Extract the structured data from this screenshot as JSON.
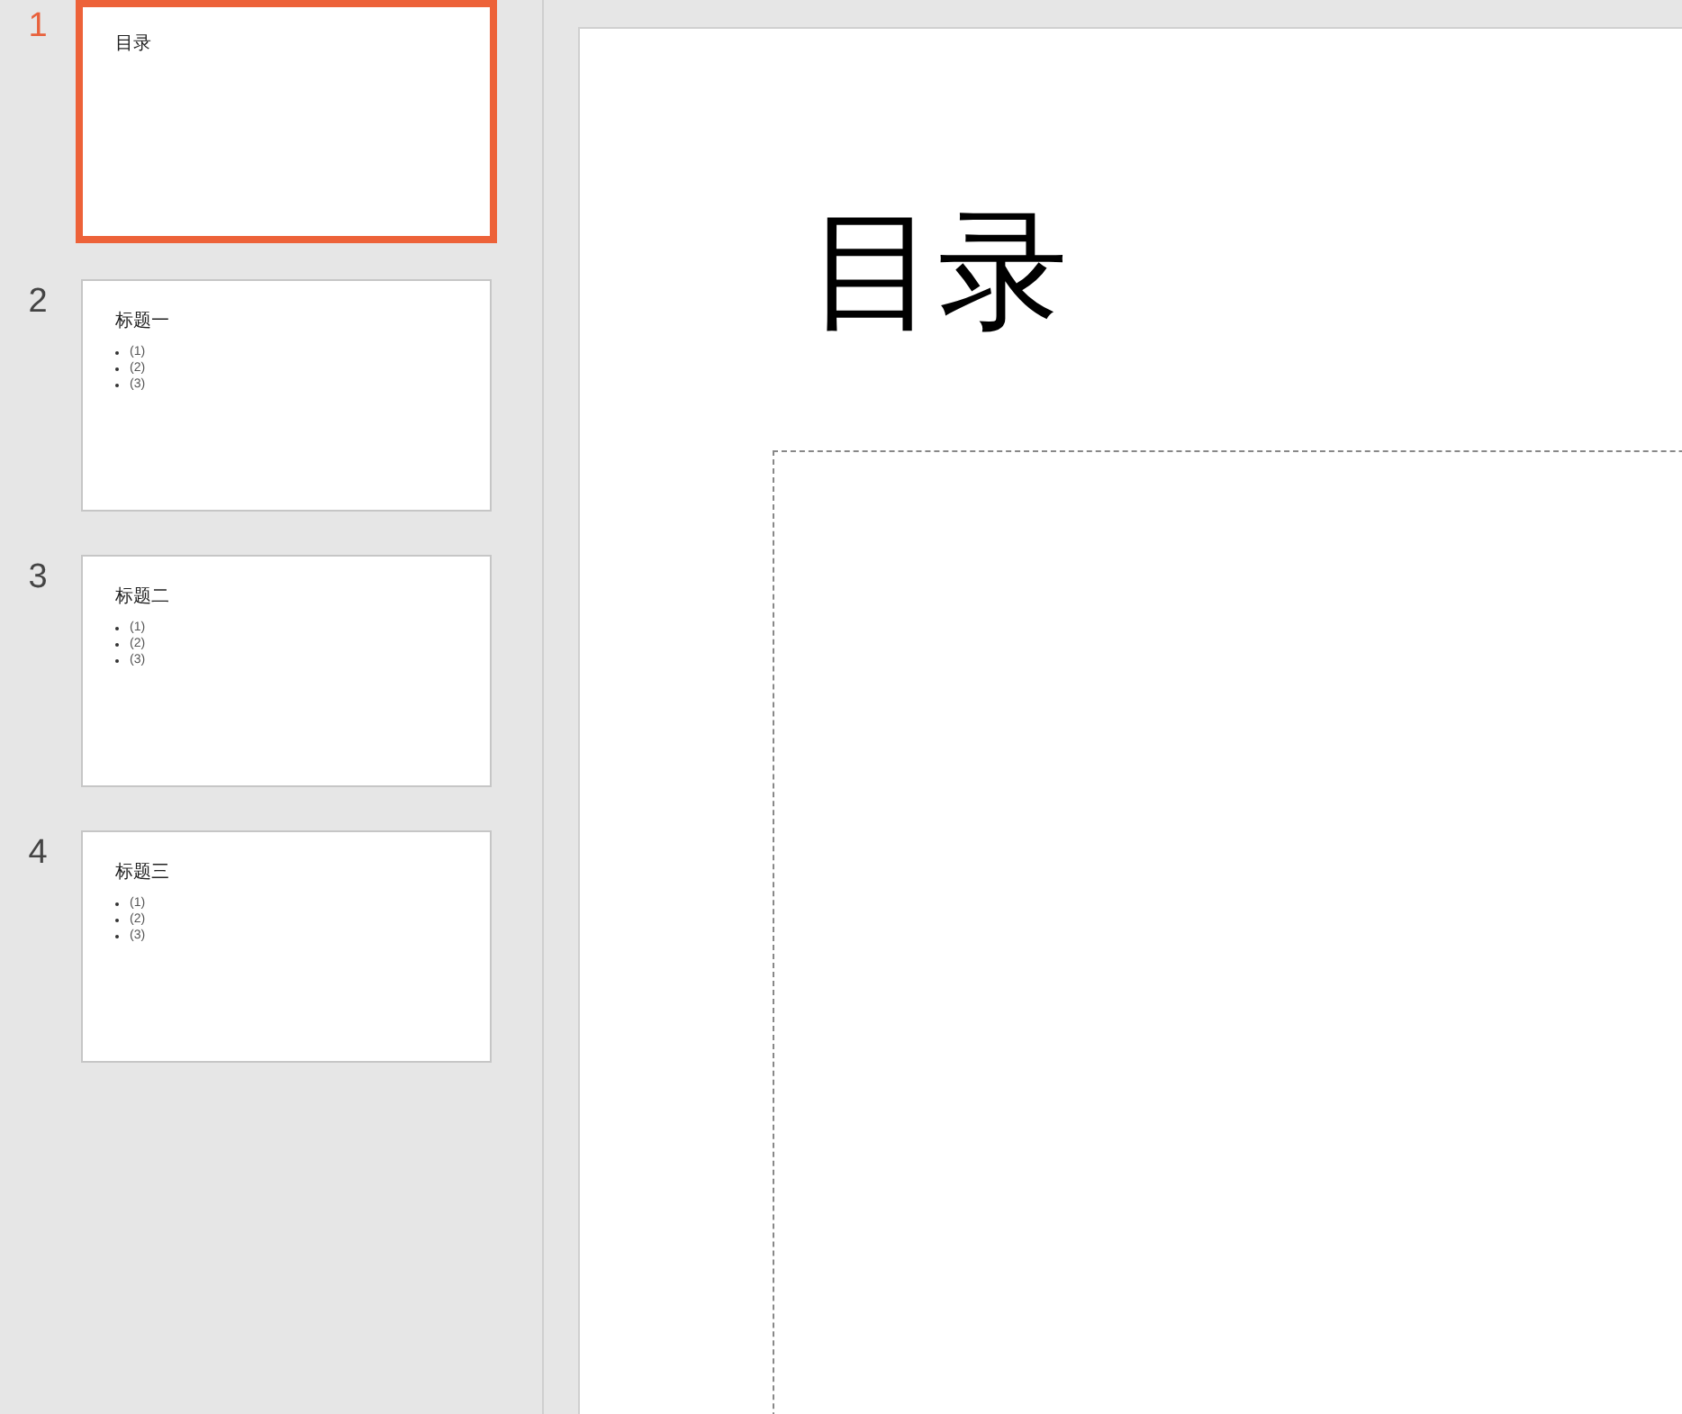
{
  "slides": [
    {
      "number": "1",
      "selected": true,
      "title": "目录"
    },
    {
      "number": "2",
      "selected": false,
      "title": "标题一",
      "bullets": [
        "(1)",
        "(2)",
        "(3)"
      ]
    },
    {
      "number": "3",
      "selected": false,
      "title": "标题二",
      "bullets": [
        "(1)",
        "(2)",
        "(3)"
      ]
    },
    {
      "number": "4",
      "selected": false,
      "title": "标题三",
      "bullets": [
        "(1)",
        "(2)",
        "(3)"
      ]
    }
  ],
  "editor": {
    "title": "目录"
  }
}
